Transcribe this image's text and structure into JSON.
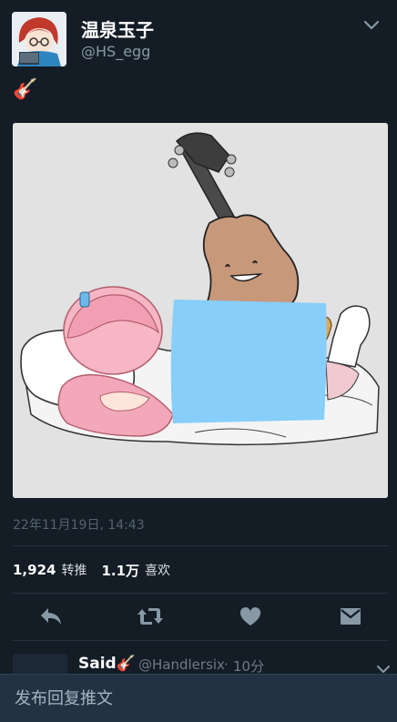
{
  "user": {
    "display_name": "温泉玉子",
    "handle": "@HS_egg"
  },
  "tweet": {
    "text": "🎸",
    "timestamp": "22年11月19日, 14:43"
  },
  "stats": {
    "retweets_count": "1,924",
    "retweets_label": "转推",
    "likes_count": "1.1万",
    "likes_label": "喜欢"
  },
  "reply_peek": {
    "name": "Said🎸",
    "handle": "@Handlersix",
    "separator": "·",
    "time": "10分"
  },
  "compose": {
    "placeholder": "发布回复推文"
  },
  "colors": {
    "background": "#141d26",
    "secondary_text": "#8899a6",
    "compose_bar": "#233242",
    "overlay_blue": "#87cefa"
  }
}
